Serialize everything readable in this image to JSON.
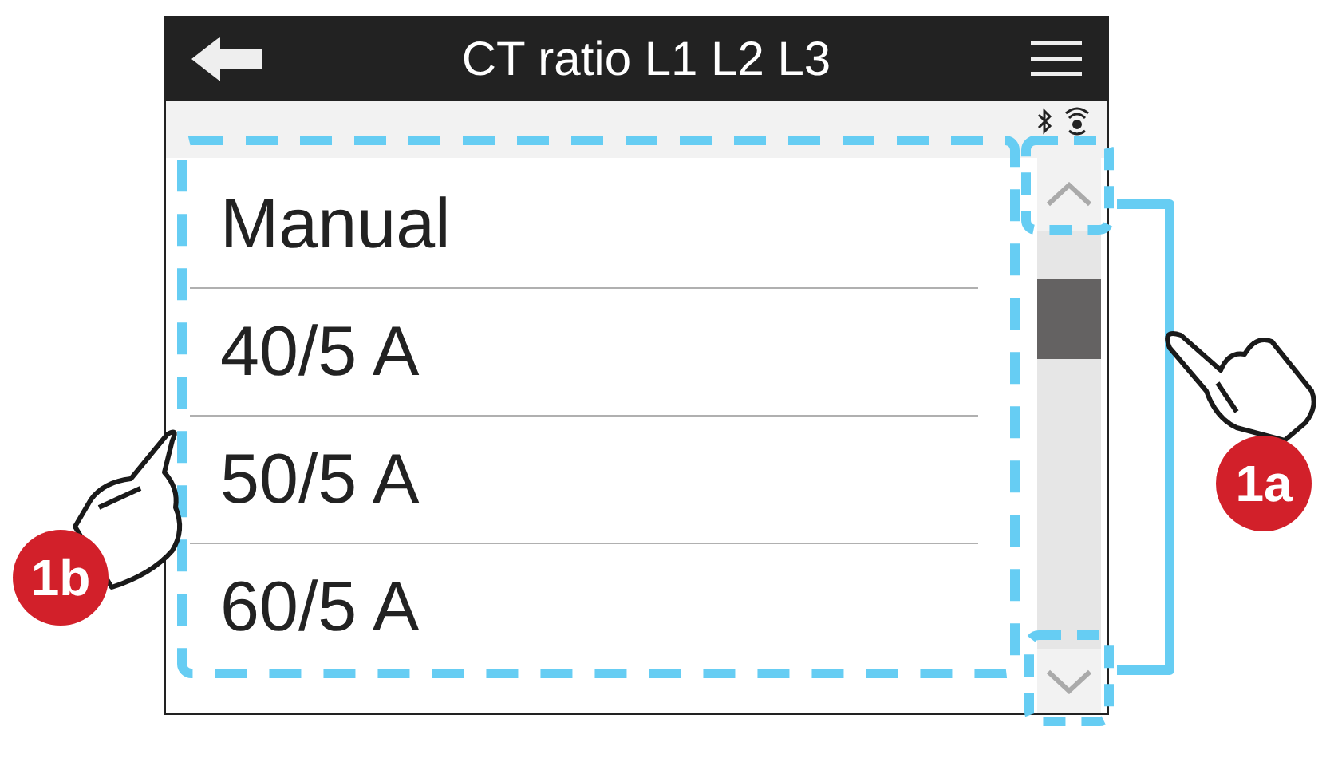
{
  "header": {
    "title": "CT ratio L1 L2 L3"
  },
  "list": {
    "items": [
      {
        "label": "Manual"
      },
      {
        "label": "40/5 A"
      },
      {
        "label": "50/5 A"
      },
      {
        "label": "60/5 A"
      }
    ]
  },
  "callouts": [
    {
      "label": "1a"
    },
    {
      "label": "1b"
    }
  ]
}
